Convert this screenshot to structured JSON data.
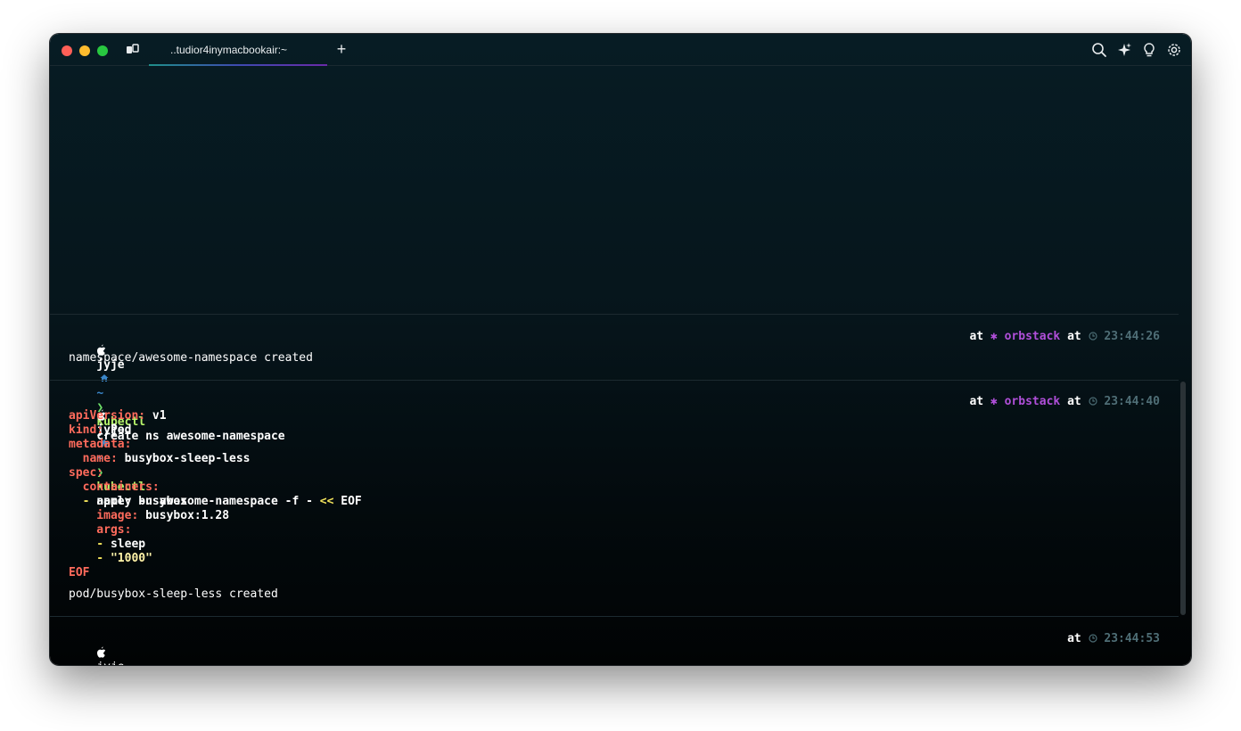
{
  "window": {
    "tab_title": "..tudior4inymacbookair:~",
    "new_tab_label": "+",
    "toolbar_icons": [
      "search-icon",
      "sparkle-ai-icon",
      "lightbulb-icon",
      "gear-icon"
    ]
  },
  "colors": {
    "command": "#b6f36a",
    "yaml_key": "#ff6b5c",
    "path": "#3a86c9",
    "context": "#b04fd9",
    "heredoc": "#f2e35c"
  },
  "blocks": [
    {
      "prompt": {
        "user": "jyje",
        "home_icon": "home-icon",
        "dir": "~",
        "chevron": "❯"
      },
      "command": {
        "name": "kubectl",
        "args": "create ns awesome-namespace"
      },
      "right_prompt": {
        "at1": "at",
        "context_icon": "✱",
        "context": "orbstack",
        "at2": "at",
        "time": "23:44:26"
      },
      "output": "namespace/awesome-namespace created"
    },
    {
      "prompt": {
        "user": "jyje",
        "home_icon": "home-icon",
        "dir": "~",
        "chevron": "❯"
      },
      "command": {
        "name": "kubectl",
        "args": "apply -n awesome-namespace -f - ",
        "heredoc_op": "<<",
        "heredoc_tag": " EOF"
      },
      "right_prompt": {
        "at1": "at",
        "context_icon": "✱",
        "context": "orbstack",
        "at2": "at",
        "time": "23:44:40"
      },
      "yaml": {
        "l1_key": "apiVersion:",
        "l1_val": " v1",
        "l2_key": "kind:",
        "l2_val": " Pod",
        "l3_key": "metadata:",
        "l4_key": "  name:",
        "l4_val": " busybox-sleep-less",
        "l5_key": "spec:",
        "l6_key": "  containers:",
        "l7_dash": "  -",
        "l7_val": " name: busybox",
        "l8_key": "    image:",
        "l8_val": " busybox:1.28",
        "l9_key": "    args:",
        "l10_dash": "    -",
        "l10_val": " sleep",
        "l11_dash": "    -",
        "l11_val": " \"1000\"",
        "eof": "EOF"
      },
      "output": "pod/busybox-sleep-less created"
    },
    {
      "prompt": {
        "user": "jyje",
        "home_icon": "home-icon",
        "dir": "~",
        "chevron": "❯"
      },
      "right_prompt": {
        "at2": "at",
        "time": "23:44:53"
      }
    }
  ]
}
